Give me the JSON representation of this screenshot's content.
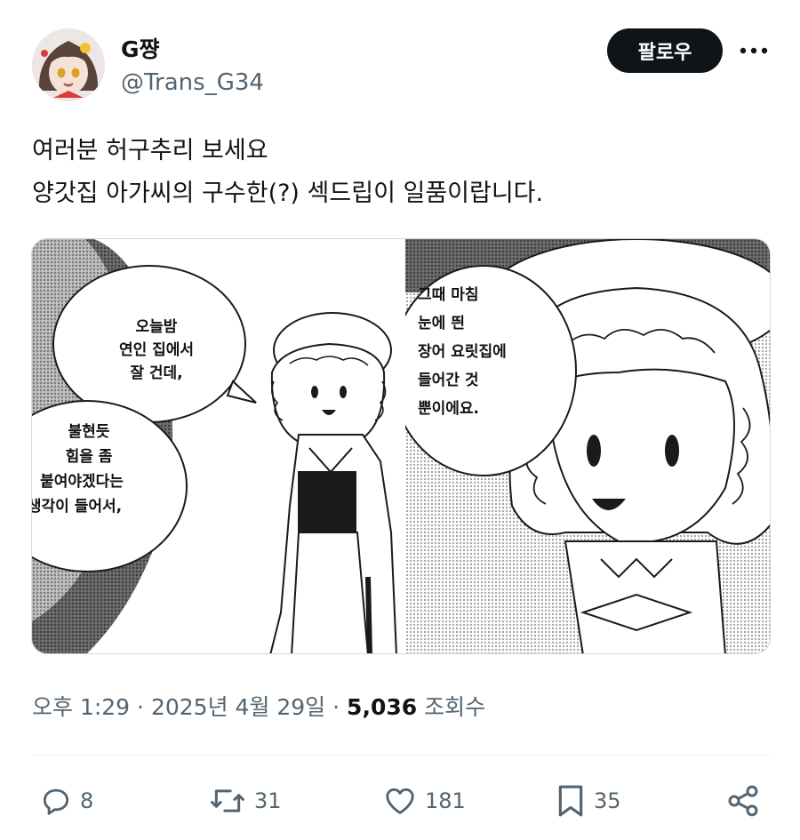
{
  "author": {
    "display_name": "G쨩",
    "handle": "@Trans_G34"
  },
  "follow_label": "팔로우",
  "tweet": {
    "lines": [
      "여러분 허구추리 보세요",
      "양갓집 아가씨의 구수한(?) 섹드립이 일품이랍니다."
    ]
  },
  "media": {
    "left_panel": {
      "bubble_top": [
        "오늘밤",
        "연인 집에서",
        "잘 건데,"
      ],
      "bubble_bottom": [
        "불현듯",
        "힘을 좀",
        "붙여야겠다는",
        "생각이 들어서,"
      ]
    },
    "right_panel": {
      "bubble": [
        "그때 마침",
        "눈에 띈",
        "장어 요릿집에",
        "들어간 것",
        "뿐이에요."
      ]
    }
  },
  "meta": {
    "time": "오후 1:29",
    "separator": "·",
    "date": "2025년 4월 29일",
    "views_count": "5,036",
    "views_label": "조회수"
  },
  "actions": {
    "replies": "8",
    "retweets": "31",
    "likes": "181",
    "bookmarks": "35"
  },
  "icons": {
    "reply": "reply-icon",
    "retweet": "retweet-icon",
    "like": "heart-icon",
    "bookmark": "bookmark-icon",
    "share": "share-icon",
    "more": "more-icon"
  },
  "colors": {
    "text_primary": "#0f1419",
    "text_secondary": "#536471",
    "follow_bg": "#0f1419",
    "border": "#cfd9de"
  }
}
